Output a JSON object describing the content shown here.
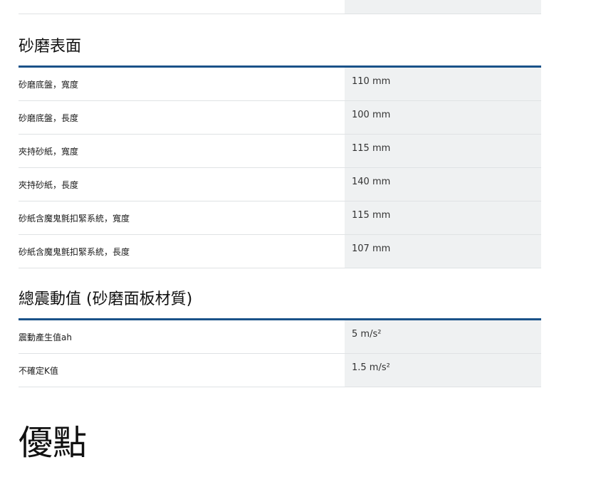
{
  "sections": [
    {
      "title": "砂磨表面",
      "rows": [
        {
          "label": "砂磨底盤，寬度",
          "value": "110 mm"
        },
        {
          "label": "砂磨底盤，長度",
          "value": "100 mm"
        },
        {
          "label": "夾持砂紙，寬度",
          "value": "115 mm"
        },
        {
          "label": "夾持砂紙，長度",
          "value": "140 mm"
        },
        {
          "label": "砂紙含魔鬼氈扣緊系統，寬度",
          "value": "115 mm"
        },
        {
          "label": "砂紙含魔鬼氈扣緊系統，長度",
          "value": "107 mm"
        }
      ]
    },
    {
      "title": "總震動值 (砂磨面板材質)",
      "rows": [
        {
          "label": "震動產生值ah",
          "value": "5 m/s²"
        },
        {
          "label": "不確定K值",
          "value": "1.5 m/s²"
        }
      ]
    }
  ],
  "benefits": {
    "title": "優點"
  }
}
